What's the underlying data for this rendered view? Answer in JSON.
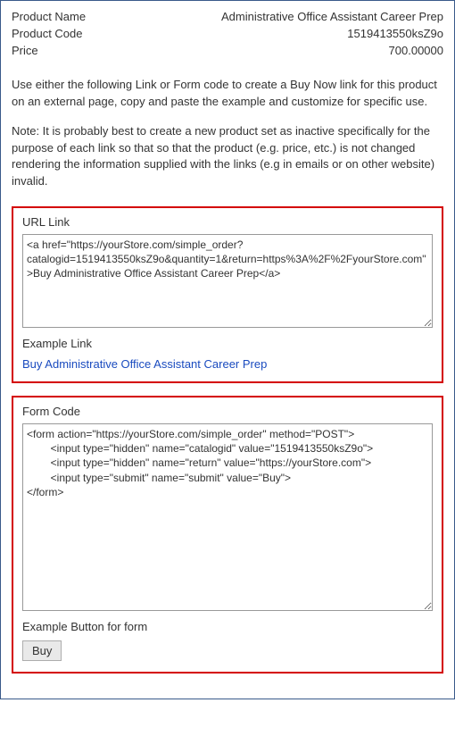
{
  "product": {
    "name_label": "Product Name",
    "name_value": "Administrative Office Assistant Career Prep",
    "code_label": "Product Code",
    "code_value": "1519413550ksZ9o",
    "price_label": "Price",
    "price_value": "700.00000"
  },
  "description": "Use either the following Link or Form code to create a Buy Now link for this product on an external page, copy and paste the example and customize for specific use.",
  "note": "Note: It is probably best to create a new product set as inactive specifically for the purpose of each link so that so that the product (e.g. price, etc.) is not changed rendering the information supplied with the links (e.g in emails or on other website) invalid.",
  "url_section": {
    "title": "URL Link",
    "code": "<a href=\"https://yourStore.com/simple_order?catalogid=1519413550ksZ9o&quantity=1&return=https%3A%2F%2FyourStore.com\">Buy Administrative Office Assistant Career Prep</a>",
    "example_label": "Example Link",
    "example_link_text": "Buy Administrative Office Assistant Career Prep"
  },
  "form_section": {
    "title": "Form Code",
    "code": "<form action=\"https://yourStore.com/simple_order\" method=\"POST\">\n        <input type=\"hidden\" name=\"catalogid\" value=\"1519413550ksZ9o\">\n        <input type=\"hidden\" name=\"return\" value=\"https://yourStore.com\">\n        <input type=\"submit\" name=\"submit\" value=\"Buy\">\n</form>",
    "example_label": "Example Button for form",
    "buy_button_label": "Buy"
  }
}
